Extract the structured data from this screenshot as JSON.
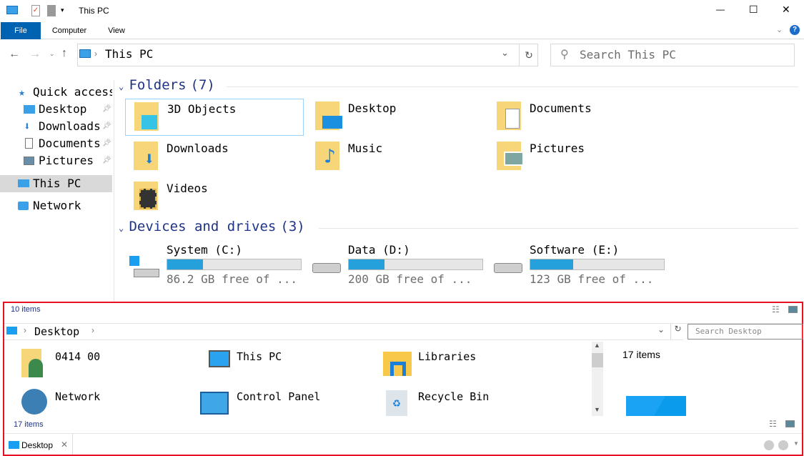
{
  "window": {
    "title": "This PC",
    "minimize": "—",
    "maximize": "☐",
    "close": "✕"
  },
  "ribbon": {
    "tabs": [
      {
        "label": "File"
      },
      {
        "label": "Computer"
      },
      {
        "label": "View"
      }
    ],
    "accent": "#0063b1"
  },
  "address": {
    "path": "This PC",
    "search_placeholder": "Search This PC"
  },
  "sidebar": {
    "items": [
      {
        "label": "Quick access",
        "icon": "star-icon"
      },
      {
        "label": "Desktop",
        "icon": "desktop-icon",
        "pinned": true
      },
      {
        "label": "Downloads",
        "icon": "download-icon",
        "pinned": true
      },
      {
        "label": "Documents",
        "icon": "document-icon",
        "pinned": true
      },
      {
        "label": "Pictures",
        "icon": "pictures-icon",
        "pinned": true
      },
      {
        "label": "This PC",
        "icon": "computer-icon",
        "selected": true
      },
      {
        "label": "Network",
        "icon": "network-icon"
      }
    ]
  },
  "folders": {
    "header": "Folders",
    "count": "(7)",
    "items": [
      {
        "label": "3D Objects"
      },
      {
        "label": "Desktop"
      },
      {
        "label": "Documents"
      },
      {
        "label": "Downloads"
      },
      {
        "label": "Music"
      },
      {
        "label": "Pictures"
      },
      {
        "label": "Videos"
      }
    ]
  },
  "drives": {
    "header": "Devices and drives",
    "count": "(3)",
    "items": [
      {
        "label": "System (C:)",
        "free": "86.2 GB free of ...",
        "used_percent": 27
      },
      {
        "label": "Data (D:)",
        "free": "200 GB free of  ...",
        "used_percent": 27
      },
      {
        "label": "Software (E:)",
        "free": "123 GB free of  ...",
        "used_percent": 32
      }
    ]
  },
  "status": {
    "items": "10 items"
  },
  "panel": {
    "path": "Desktop",
    "search_placeholder": "Search Desktop",
    "items": [
      {
        "label": "0414 00"
      },
      {
        "label": "This PC"
      },
      {
        "label": "Libraries"
      },
      {
        "label": "Network"
      },
      {
        "label": "Control Panel"
      },
      {
        "label": "Recycle Bin"
      }
    ],
    "preview_count": "17 items",
    "status": "17 items",
    "tab": "Desktop",
    "tab_close": "✕"
  }
}
